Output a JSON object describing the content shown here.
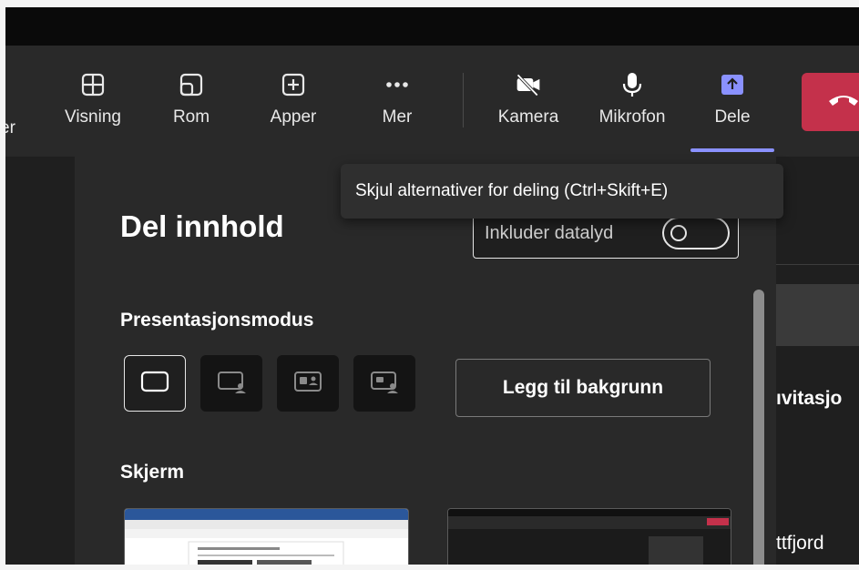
{
  "toolbar": {
    "clipped_label": "er",
    "items": [
      {
        "label": "Visning",
        "icon": "grid-icon"
      },
      {
        "label": "Rom",
        "icon": "rooms-icon"
      },
      {
        "label": "Apper",
        "icon": "plus-box-icon"
      },
      {
        "label": "Mer",
        "icon": "ellipsis-icon"
      },
      {
        "label": "Kamera",
        "icon": "camera-off-icon"
      },
      {
        "label": "Mikrofon",
        "icon": "microphone-icon"
      },
      {
        "label": "Dele",
        "icon": "share-icon"
      }
    ],
    "share_accent": "#8a91ff",
    "leave_color": "#c4314b"
  },
  "tooltip": {
    "text": "Skjul alternativer for deling (Ctrl+Skift+E)"
  },
  "share_panel": {
    "title": "Del innhold",
    "include_audio_label": "Inkluder datalyd",
    "include_audio_on": false,
    "presentation_heading": "Presentasjonsmodus",
    "modes": [
      "content-only",
      "standout",
      "side-by-side",
      "reporter"
    ],
    "selected_mode": "content-only",
    "add_background_label": "Legg til bakgrunn",
    "screen_heading": "Skjerm"
  },
  "side_panel": {
    "clipped_text_1": "ıvitasjo",
    "clipped_text_2": "ttfjord"
  }
}
